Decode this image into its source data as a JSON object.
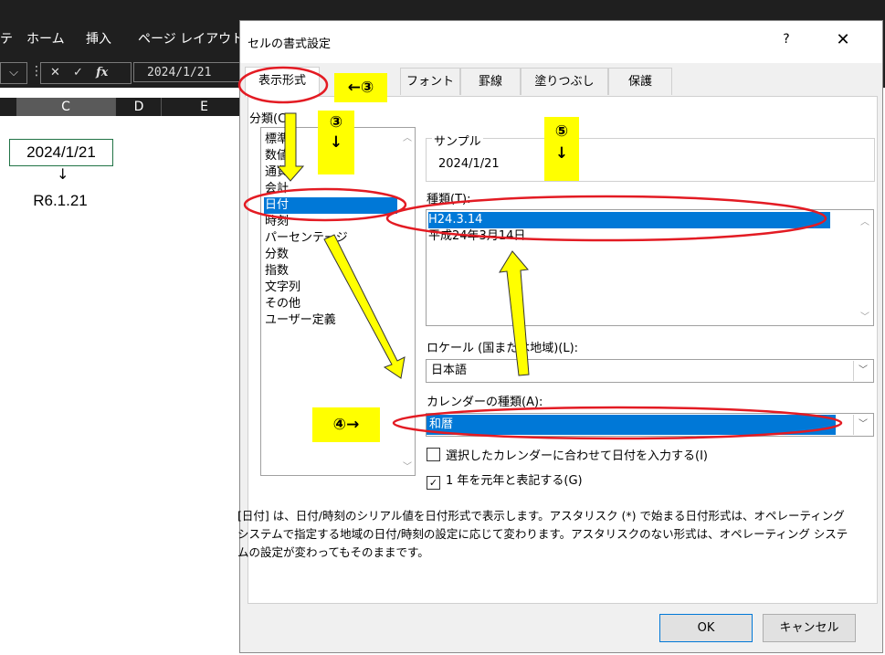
{
  "ribbon": {
    "tabs": [
      "ホーム",
      "挿入",
      "ページ レイアウト"
    ],
    "left_fragment": "テ"
  },
  "formula": {
    "cancel_icon": "x-icon",
    "enter_icon": "check-icon",
    "fx_label": "fx",
    "value": "2024/1/21"
  },
  "columns": [
    "C",
    "D",
    "E"
  ],
  "sheet": {
    "cell_value": "2024/1/21",
    "arrow": "↓",
    "result": "R6.1.21"
  },
  "dialog": {
    "title": "セルの書式設定",
    "help": "?",
    "close": "✕",
    "tabs": [
      "表示形式",
      "フォント",
      "罫線",
      "塗りつぶし",
      "保護"
    ],
    "category_label": "分類(C):",
    "categories": [
      "標準",
      "数値",
      "通貨",
      "会計",
      "日付",
      "時刻",
      "パーセンテージ",
      "分数",
      "指数",
      "文字列",
      "その他",
      "ユーザー定義"
    ],
    "selected_category": "日付",
    "sample_label": "サンプル",
    "sample_value": "2024/1/21",
    "type_label": "種類(T):",
    "types": [
      "H24.3.14",
      "平成24年3月14日"
    ],
    "locale_label": "ロケール (国または地域)(L):",
    "locale_value": "日本語",
    "calendar_label": "カレンダーの種類(A):",
    "calendar_value": "和暦",
    "checkbox1_label": "選択したカレンダーに合わせて日付を入力する(I)",
    "checkbox1_checked": false,
    "checkbox2_label": "1 年を元年と表記する(G)",
    "checkbox2_checked": true,
    "description": "[日付] は、日付/時刻のシリアル値を日付形式で表示します。アスタリスク (*) で始まる日付形式は、オペレーティング システムで指定する地域の日付/時刻の設定に応じて変わります。アスタリスクのない形式は、オペレーティング システムの設定が変わってもそのままです。",
    "ok": "OK",
    "cancel": "キャンセル"
  },
  "annotations": {
    "step3_tab": "←③",
    "step3_list": "③",
    "step3_arrow": "↓",
    "step5": "⑤",
    "step5_arrow": "↓",
    "step4": "④→"
  },
  "colors": {
    "selection": "#0078d7",
    "annotation_yellow": "#ffff00",
    "annotation_red": "#e31b23",
    "excel_dark": "#1f1f1f"
  }
}
